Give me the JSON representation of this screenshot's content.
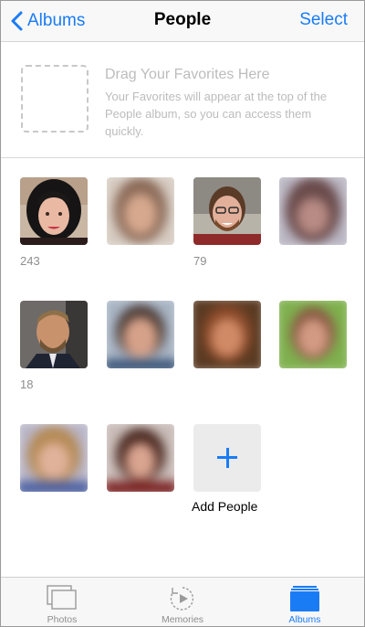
{
  "nav": {
    "back_label": "Albums",
    "title": "People",
    "select_label": "Select"
  },
  "favorites": {
    "title": "Drag Your Favorites Here",
    "description": "Your Favorites will appear at the top of the People album, so you can access them quickly."
  },
  "people": [
    {
      "count": "243"
    },
    {
      "count": ""
    },
    {
      "count": "79"
    },
    {
      "count": ""
    },
    {
      "count": "18"
    },
    {
      "count": ""
    },
    {
      "count": ""
    },
    {
      "count": ""
    },
    {
      "count": ""
    },
    {
      "count": ""
    }
  ],
  "add_people": {
    "label": "Add People"
  },
  "tabs": [
    {
      "label": "Photos",
      "icon": "photos-icon"
    },
    {
      "label": "Memories",
      "icon": "memories-icon"
    },
    {
      "label": "Albums",
      "icon": "albums-icon",
      "active": true
    }
  ],
  "colors": {
    "accent": "#1a7cf5",
    "tab_inactive": "#8e8e8e"
  }
}
